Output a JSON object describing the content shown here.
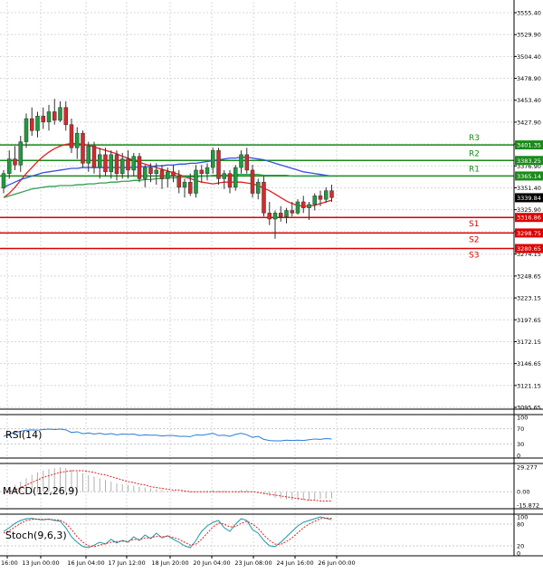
{
  "chart_data": {
    "type": "candlestick",
    "grid": true,
    "price_axis": {
      "ticks": [
        "3555.40",
        "3529.90",
        "3504.40",
        "3478.90",
        "3453.40",
        "3427.90",
        "3402.40",
        "3376.90",
        "3351.40",
        "3325.90",
        "3300.40",
        "3274.15",
        "3248.65",
        "3223.15",
        "3197.65",
        "3172.15",
        "3146.65",
        "3121.15",
        "3095.65"
      ],
      "range": [
        3095.65,
        3555.4
      ]
    },
    "time_axis": {
      "labels": [
        "16:00",
        "13 Jun 00:00",
        "16 Jun 04:00",
        "17 Jun 12:00",
        "18 Jun 20:00",
        "20 Jun 04:00",
        "23 Jun 08:00",
        "24 Jun 16:00",
        "26 Jun 00:00"
      ]
    },
    "levels": [
      {
        "name": "R3",
        "value": "3401.35",
        "color": "#1a8a1a"
      },
      {
        "name": "R2",
        "value": "3383.25",
        "color": "#1a8a1a"
      },
      {
        "name": "R1",
        "value": "3365.14",
        "color": "#1a8a1a"
      },
      {
        "name": "S1",
        "value": "3316.86",
        "color": "#dd0000"
      },
      {
        "name": "S2",
        "value": "3298.75",
        "color": "#dd0000"
      },
      {
        "name": "S3",
        "value": "3280.65",
        "color": "#dd0000"
      }
    ],
    "current_price": "3339.84",
    "candles": [
      [
        3351,
        3372,
        3345,
        3368
      ],
      [
        3368,
        3395,
        3362,
        3385
      ],
      [
        3385,
        3400,
        3372,
        3378
      ],
      [
        3378,
        3412,
        3370,
        3405
      ],
      [
        3405,
        3438,
        3398,
        3432
      ],
      [
        3432,
        3445,
        3412,
        3418
      ],
      [
        3418,
        3440,
        3410,
        3435
      ],
      [
        3435,
        3445,
        3420,
        3428
      ],
      [
        3428,
        3448,
        3418,
        3440
      ],
      [
        3440,
        3455,
        3425,
        3430
      ],
      [
        3430,
        3452,
        3428,
        3445
      ],
      [
        3445,
        3452,
        3418,
        3425
      ],
      [
        3425,
        3432,
        3392,
        3398
      ],
      [
        3398,
        3422,
        3385,
        3415
      ],
      [
        3415,
        3418,
        3375,
        3380
      ],
      [
        3380,
        3405,
        3370,
        3400
      ],
      [
        3400,
        3405,
        3368,
        3375
      ],
      [
        3375,
        3398,
        3362,
        3390
      ],
      [
        3390,
        3398,
        3365,
        3370
      ],
      [
        3370,
        3395,
        3362,
        3390
      ],
      [
        3390,
        3395,
        3360,
        3368
      ],
      [
        3368,
        3392,
        3362,
        3385
      ],
      [
        3385,
        3395,
        3362,
        3372
      ],
      [
        3372,
        3392,
        3365,
        3388
      ],
      [
        3388,
        3392,
        3358,
        3362
      ],
      [
        3362,
        3378,
        3352,
        3375
      ],
      [
        3375,
        3380,
        3358,
        3368
      ],
      [
        3368,
        3380,
        3355,
        3372
      ],
      [
        3372,
        3378,
        3350,
        3362
      ],
      [
        3362,
        3375,
        3352,
        3370
      ],
      [
        3370,
        3378,
        3358,
        3365
      ],
      [
        3365,
        3372,
        3345,
        3352
      ],
      [
        3352,
        3362,
        3340,
        3358
      ],
      [
        3358,
        3368,
        3342,
        3345
      ],
      [
        3345,
        3378,
        3340,
        3372
      ],
      [
        3372,
        3378,
        3358,
        3368
      ],
      [
        3368,
        3380,
        3360,
        3375
      ],
      [
        3375,
        3398,
        3368,
        3395
      ],
      [
        3395,
        3398,
        3355,
        3362
      ],
      [
        3362,
        3372,
        3350,
        3368
      ],
      [
        3368,
        3372,
        3345,
        3352
      ],
      [
        3352,
        3378,
        3348,
        3375
      ],
      [
        3375,
        3395,
        3368,
        3390
      ],
      [
        3390,
        3398,
        3368,
        3372
      ],
      [
        3372,
        3378,
        3340,
        3345
      ],
      [
        3345,
        3362,
        3338,
        3358
      ],
      [
        3358,
        3365,
        3318,
        3322
      ],
      [
        3322,
        3335,
        3308,
        3315
      ],
      [
        3315,
        3325,
        3292,
        3322
      ],
      [
        3322,
        3330,
        3312,
        3318
      ],
      [
        3318,
        3328,
        3310,
        3325
      ],
      [
        3325,
        3335,
        3318,
        3322
      ],
      [
        3322,
        3338,
        3320,
        3335
      ],
      [
        3335,
        3342,
        3322,
        3328
      ],
      [
        3328,
        3335,
        3314,
        3332
      ],
      [
        3332,
        3345,
        3325,
        3342
      ],
      [
        3342,
        3348,
        3330,
        3338
      ],
      [
        3338,
        3352,
        3334,
        3348
      ],
      [
        3348,
        3355,
        3335,
        3340
      ]
    ],
    "moving_averages": [
      {
        "color": "#e02020",
        "values": [
          3340,
          3345,
          3352,
          3360,
          3368,
          3375,
          3382,
          3388,
          3393,
          3397,
          3400,
          3402,
          3403,
          3403,
          3402,
          3401,
          3399,
          3397,
          3395,
          3393,
          3391,
          3388,
          3386,
          3383,
          3381,
          3379,
          3377,
          3375,
          3373,
          3371,
          3369,
          3367,
          3364,
          3362,
          3360,
          3358,
          3357,
          3356,
          3357,
          3358,
          3358,
          3358,
          3358,
          3357,
          3356,
          3354,
          3351,
          3348,
          3344,
          3340,
          3336,
          3333,
          3331,
          3330,
          3330,
          3331,
          3333,
          3335,
          3337
        ]
      },
      {
        "color": "#3050e0",
        "values": [
          3352,
          3355,
          3358,
          3361,
          3363,
          3365,
          3367,
          3369,
          3370,
          3371,
          3372,
          3373,
          3374,
          3374,
          3375,
          3375,
          3375,
          3375,
          3375,
          3375,
          3375,
          3375,
          3375,
          3375,
          3376,
          3376,
          3376,
          3377,
          3377,
          3378,
          3378,
          3379,
          3379,
          3380,
          3380,
          3381,
          3382,
          3383,
          3384,
          3385,
          3386,
          3386,
          3387,
          3387,
          3386,
          3385,
          3384,
          3382,
          3380,
          3378,
          3376,
          3374,
          3372,
          3370,
          3369,
          3368,
          3367,
          3366,
          3365
        ]
      },
      {
        "color": "#30a050",
        "values": [
          3340,
          3342,
          3344,
          3346,
          3348,
          3350,
          3351,
          3352,
          3353,
          3353,
          3354,
          3354,
          3354,
          3355,
          3355,
          3356,
          3356,
          3357,
          3357,
          3358,
          3358,
          3359,
          3359,
          3360,
          3360,
          3361,
          3361,
          3362,
          3362,
          3363,
          3363,
          3363,
          3364,
          3364,
          3364,
          3365,
          3365,
          3366,
          3366,
          3366,
          3366,
          3367,
          3367,
          3367,
          3367,
          3367,
          3366,
          3366,
          3366,
          3366,
          3366,
          3365,
          3365,
          3365,
          3365,
          3365,
          3365,
          3365,
          3365
        ]
      }
    ],
    "rsi": {
      "label": "RSI(14)",
      "ticks": [
        "100",
        "70",
        "30",
        "0"
      ],
      "levels": [
        70,
        30
      ],
      "values": [
        50,
        56,
        60,
        63,
        66,
        67,
        66,
        68,
        69,
        68,
        69,
        67,
        60,
        62,
        57,
        59,
        56,
        58,
        55,
        57,
        54,
        56,
        55,
        56,
        52,
        54,
        53,
        53,
        51,
        52,
        52,
        50,
        50,
        49,
        54,
        53,
        55,
        58,
        52,
        53,
        50,
        55,
        58,
        54,
        47,
        50,
        42,
        39,
        38,
        38,
        40,
        39,
        40,
        39,
        41,
        43,
        42,
        44,
        43
      ]
    },
    "macd": {
      "label": "MACD(12,26,9)",
      "ticks": [
        "29.277",
        "0.00",
        "-15.872"
      ],
      "histogram": [
        2,
        5,
        8,
        12,
        16,
        20,
        23,
        25,
        27,
        28,
        29,
        28,
        26,
        24,
        22,
        20,
        18,
        16,
        14,
        12,
        10,
        9,
        8,
        7,
        6,
        5,
        4,
        3,
        2,
        1,
        1,
        0,
        -1,
        -1,
        0,
        0,
        1,
        2,
        1,
        1,
        0,
        1,
        2,
        2,
        0,
        -1,
        -3,
        -5,
        -7,
        -8,
        -9,
        -10,
        -10,
        -10,
        -10,
        -9,
        -9,
        -8,
        -8
      ],
      "signal": [
        -2,
        0,
        2,
        5,
        8,
        11,
        14,
        17,
        19,
        21,
        23,
        24,
        25,
        25,
        25,
        24,
        23,
        21,
        20,
        18,
        16,
        14,
        12,
        11,
        9,
        8,
        6,
        5,
        4,
        3,
        2,
        2,
        1,
        0,
        0,
        0,
        0,
        0,
        0,
        0,
        0,
        0,
        0,
        0,
        0,
        -1,
        -2,
        -3,
        -4,
        -5,
        -6,
        -7,
        -8,
        -9,
        -10,
        -10,
        -11,
        -11,
        -11
      ]
    },
    "stoch": {
      "label": "Stoch(9,6,3)",
      "ticks": [
        "100",
        "80",
        "20",
        "0"
      ],
      "levels": [
        80,
        20
      ],
      "k": [
        60,
        70,
        82,
        90,
        95,
        96,
        93,
        92,
        94,
        90,
        88,
        70,
        45,
        30,
        18,
        15,
        22,
        30,
        25,
        38,
        28,
        35,
        30,
        45,
        35,
        50,
        40,
        55,
        42,
        48,
        38,
        30,
        20,
        15,
        35,
        60,
        75,
        85,
        90,
        70,
        60,
        80,
        95,
        90,
        65,
        55,
        35,
        20,
        18,
        30,
        45,
        60,
        75,
        85,
        90,
        95,
        100,
        96,
        92
      ],
      "d": [
        55,
        62,
        72,
        82,
        90,
        93,
        94,
        93,
        93,
        92,
        91,
        82,
        65,
        45,
        30,
        20,
        18,
        22,
        26,
        30,
        32,
        33,
        32,
        38,
        37,
        42,
        42,
        46,
        45,
        47,
        43,
        38,
        30,
        22,
        25,
        38,
        55,
        72,
        83,
        80,
        72,
        73,
        82,
        88,
        80,
        68,
        50,
        35,
        25,
        24,
        32,
        42,
        56,
        70,
        80,
        88,
        95,
        97,
        96
      ]
    }
  }
}
